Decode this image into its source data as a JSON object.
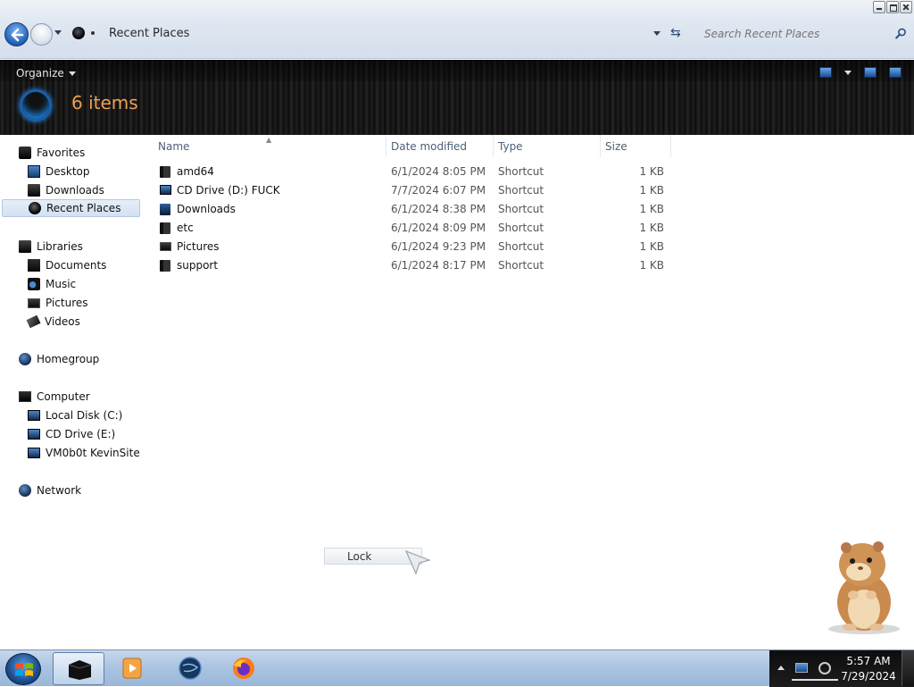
{
  "window": {
    "address": "Recent Places",
    "search_placeholder": "Search Recent Places"
  },
  "toolbar": {
    "organize_label": "Organize",
    "items_count": "6 items"
  },
  "navpane": {
    "favorites": {
      "label": "Favorites",
      "items": [
        "Desktop",
        "Downloads",
        "Recent Places"
      ]
    },
    "libraries": {
      "label": "Libraries",
      "items": [
        "Documents",
        "Music",
        "Pictures",
        "Videos"
      ]
    },
    "homegroup": {
      "label": "Homegroup"
    },
    "computer": {
      "label": "Computer",
      "items": [
        "Local Disk (C:)",
        "CD Drive (E:)",
        "VM0b0t KevinSite"
      ]
    },
    "network": {
      "label": "Network"
    },
    "selected": "Recent Places"
  },
  "filelist": {
    "columns": [
      "Name",
      "Date modified",
      "Type",
      "Size"
    ],
    "rows": [
      {
        "name": "amd64",
        "date": "6/1/2024 8:05 PM",
        "type": "Shortcut",
        "size": "1 KB",
        "icon": "dark-folder-icon"
      },
      {
        "name": "CD Drive (D:) FUCK",
        "date": "7/7/2024 6:07 PM",
        "type": "Shortcut",
        "size": "1 KB",
        "icon": "cd-drive-icon"
      },
      {
        "name": "Downloads",
        "date": "6/1/2024 8:38 PM",
        "type": "Shortcut",
        "size": "1 KB",
        "icon": "downloads-icon"
      },
      {
        "name": "etc",
        "date": "6/1/2024 8:09 PM",
        "type": "Shortcut",
        "size": "1 KB",
        "icon": "dark-folder-icon"
      },
      {
        "name": "Pictures",
        "date": "6/1/2024 9:23 PM",
        "type": "Shortcut",
        "size": "1 KB",
        "icon": "pictures-icon"
      },
      {
        "name": "support",
        "date": "6/1/2024 8:17 PM",
        "type": "Shortcut",
        "size": "1 KB",
        "icon": "dark-folder-icon"
      }
    ]
  },
  "tooltip": {
    "lock_label": "Lock"
  },
  "taskbar": {
    "time": "5:57 AM",
    "date": "7/29/2024",
    "pinned": [
      "explorer-icon",
      "media-player-icon",
      "browser-globe-icon",
      "firefox-icon"
    ]
  },
  "colors": {
    "accent": "#1f5fb5",
    "items_count": "#f0a050",
    "header_bg": "#141414",
    "taskbar": "#a9c3e0"
  }
}
